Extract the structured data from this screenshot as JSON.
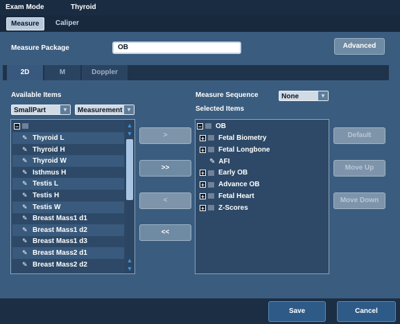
{
  "header": {
    "mode_label": "Exam Mode",
    "mode_value": "Thyroid"
  },
  "tabs": {
    "measure": "Measure",
    "caliper": "Caliper"
  },
  "package": {
    "label": "Measure Package",
    "value": "OB",
    "advanced": "Advanced"
  },
  "subtabs": {
    "tab_2d": "2D",
    "tab_m": "M",
    "tab_doppler": "Doppler"
  },
  "available": {
    "label": "Available Items",
    "filter1": "SmallPart",
    "filter2": "Measurement",
    "root_icon": "root-folder",
    "items": [
      "Thyroid L",
      "Thyroid H",
      "Thyroid W",
      "Isthmus H",
      "Testis L",
      "Testis H",
      "Testis W",
      "Breast Mass1 d1",
      "Breast Mass1 d2",
      "Breast Mass1 d3",
      "Breast Mass2 d1",
      "Breast Mass2 d2"
    ]
  },
  "transfer": {
    "add": ">",
    "add_all": ">>",
    "remove": "<",
    "remove_all": "<<"
  },
  "sequence": {
    "label": "Measure Sequence",
    "value": "None"
  },
  "selected": {
    "label": "Selected Items",
    "root": "OB",
    "items": [
      {
        "label": "Fetal Biometry",
        "expander": "+"
      },
      {
        "label": "Fetal Longbone",
        "expander": "+"
      },
      {
        "label": "AFI",
        "expander": ""
      },
      {
        "label": "Early OB",
        "expander": "+"
      },
      {
        "label": "Advance OB",
        "expander": "+"
      },
      {
        "label": "Fetal Heart",
        "expander": "+"
      },
      {
        "label": "Z-Scores",
        "expander": "+"
      }
    ]
  },
  "actions": {
    "default": "Default",
    "move_up": "Move Up",
    "move_down": "Move Down"
  },
  "footer": {
    "save": "Save",
    "cancel": "Cancel"
  }
}
